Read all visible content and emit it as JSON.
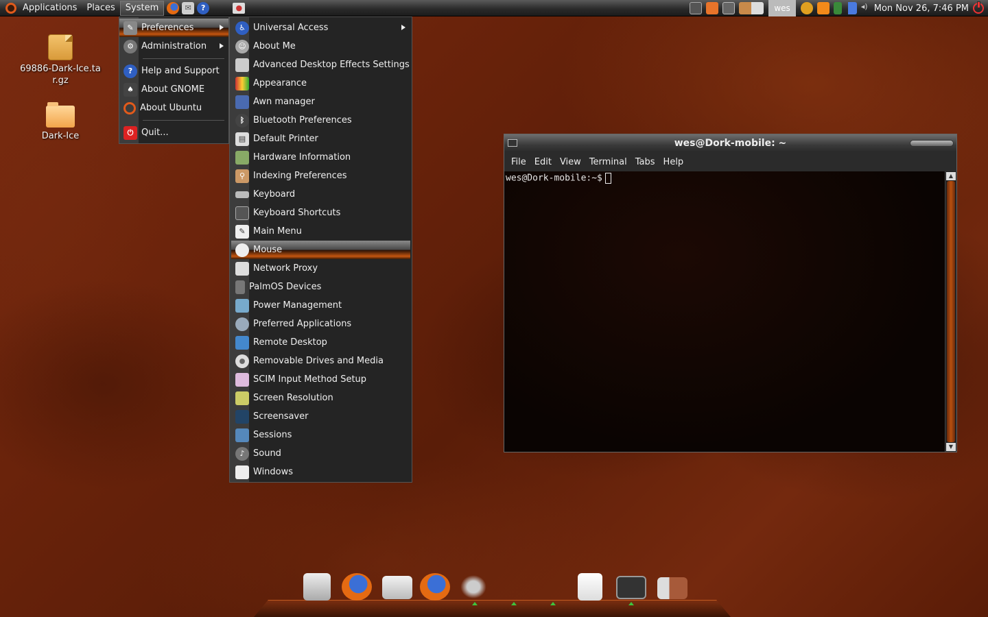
{
  "top_panel": {
    "applications": "Applications",
    "places": "Places",
    "system": "System",
    "launchers": [
      "firefox-icon",
      "mail-icon",
      "help-icon",
      "screenshot-icon",
      "terminal-icon"
    ],
    "tray_icons": [
      "window-icon",
      "home-icon",
      "display-icon",
      "workspace-icon"
    ],
    "user": "wes",
    "clock": "Mon Nov 26,  7:46 PM"
  },
  "desktop": {
    "icons": [
      {
        "label": "69886-Dark-Ice.tar.gz",
        "type": "archive"
      },
      {
        "label": "Dark-Ice",
        "type": "folder"
      }
    ]
  },
  "system_menu": {
    "items": [
      {
        "label": "Preferences",
        "submenu": true,
        "icon": "preferences-icon"
      },
      {
        "label": "Administration",
        "submenu": true,
        "icon": "administration-icon"
      },
      {
        "label": "Help and Support",
        "icon": "help-icon"
      },
      {
        "label": "About GNOME",
        "icon": "gnome-icon"
      },
      {
        "label": "About Ubuntu",
        "icon": "ubuntu-icon"
      },
      {
        "label": "Quit...",
        "icon": "quit-icon"
      }
    ]
  },
  "preferences_menu": {
    "items": [
      {
        "label": "Universal Access",
        "submenu": true
      },
      {
        "label": "About Me"
      },
      {
        "label": "Advanced Desktop Effects Settings"
      },
      {
        "label": "Appearance"
      },
      {
        "label": "Awn manager"
      },
      {
        "label": "Bluetooth Preferences"
      },
      {
        "label": "Default Printer"
      },
      {
        "label": "Hardware Information"
      },
      {
        "label": "Indexing Preferences"
      },
      {
        "label": "Keyboard"
      },
      {
        "label": "Keyboard Shortcuts"
      },
      {
        "label": "Main Menu"
      },
      {
        "label": "Mouse"
      },
      {
        "label": "Network Proxy"
      },
      {
        "label": "PalmOS Devices"
      },
      {
        "label": "Power Management"
      },
      {
        "label": "Preferred Applications"
      },
      {
        "label": "Remote Desktop"
      },
      {
        "label": "Removable Drives and Media"
      },
      {
        "label": "SCIM Input Method Setup"
      },
      {
        "label": "Screen Resolution"
      },
      {
        "label": "Screensaver"
      },
      {
        "label": "Sessions"
      },
      {
        "label": "Sound"
      },
      {
        "label": "Windows"
      }
    ],
    "highlighted": "Mouse"
  },
  "terminal": {
    "title": "wes@Dork-mobile: ~",
    "menus": [
      "File",
      "Edit",
      "View",
      "Terminal",
      "Tabs",
      "Help"
    ],
    "prompt": "wes@Dork-mobile:~$"
  },
  "dock": {
    "items": [
      "archive-manager-icon",
      "firefox-icon",
      "drive-icon",
      "firefox-icon",
      "gimp-icon",
      "text-editor-icon",
      "terminal-icon",
      "image-viewer-icon"
    ]
  },
  "colors": {
    "accent": "#c5560f",
    "panel": "#2b2b2b",
    "menu_bg": "#242424"
  }
}
